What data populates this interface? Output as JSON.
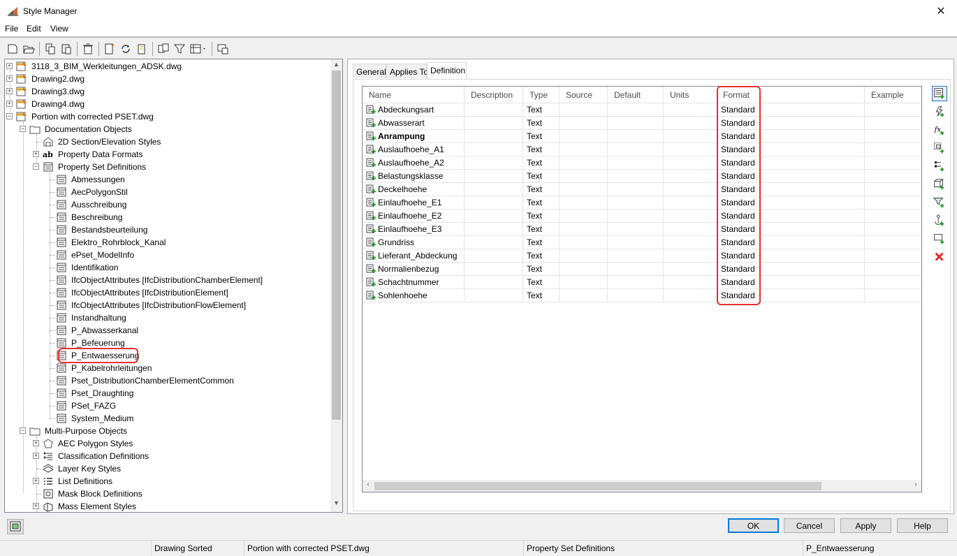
{
  "window": {
    "title": "Style Manager",
    "close_glyph": "✕"
  },
  "menu": {
    "items": [
      "File",
      "Edit",
      "View"
    ]
  },
  "toolbar": {
    "icons": [
      "new-drawing-icon",
      "open-drawing-icon",
      "copy-icon",
      "paste-icon",
      "purge-icon",
      "edit-style-icon",
      "synchronize-icon",
      "export-icon",
      "toggle-view-icon",
      "filter-icon",
      "view-options-icon",
      "inline-edit-icon"
    ]
  },
  "tree": {
    "drawings": [
      "3118_3_BIM_Werkleitungen_ADSK.dwg",
      "Drawing2.dwg",
      "Drawing3.dwg",
      "Drawing4.dwg",
      "Portion with corrected PSET.dwg"
    ],
    "documentation_objects": "Documentation Objects",
    "doc_children": [
      "2D Section/Elevation Styles",
      "Property Data Formats",
      "Property Set Definitions"
    ],
    "property_sets": [
      "Abmessungen",
      "AecPolygonStil",
      "Ausschreibung",
      "Beschreibung",
      "Bestandsbeurteilung",
      "Elektro_Rohrblock_Kanal",
      "ePset_ModelInfo",
      "Identifikation",
      "IfcObjectAttributes [IfcDistributionChamberElement]",
      "IfcObjectAttributes [IfcDistributionElement]",
      "IfcObjectAttributes [IfcDistributionFlowElement]",
      "Instandhaltung",
      "P_Abwasserkanal",
      "P_Befeuerung",
      "P_Entwaesserung",
      "P_Kabelrohrleitungen",
      "Pset_DistributionChamberElementCommon",
      "Pset_Draughting",
      "PSet_FAZG",
      "System_Medium"
    ],
    "multi_purpose_objects": "Multi-Purpose Objects",
    "mpo_children": [
      "AEC Polygon Styles",
      "Classification Definitions",
      "Layer Key Styles",
      "List Definitions",
      "Mask Block Definitions",
      "Mass Element Styles"
    ],
    "selected": "P_Entwaesserung"
  },
  "tabs": [
    "General",
    "Applies To",
    "Definition"
  ],
  "active_tab": "Definition",
  "grid": {
    "columns": [
      "Name",
      "Description",
      "Type",
      "Source",
      "Default",
      "Units",
      "Format",
      "Example"
    ],
    "rows": [
      {
        "name": "Abdeckungsart",
        "type": "Text",
        "format": "Standard"
      },
      {
        "name": "Abwasserart",
        "type": "Text",
        "format": "Standard"
      },
      {
        "name": "Anrampung",
        "type": "Text",
        "format": "Standard",
        "bold": true
      },
      {
        "name": "Auslaufhoehe_A1",
        "type": "Text",
        "format": "Standard"
      },
      {
        "name": "Auslaufhoehe_A2",
        "type": "Text",
        "format": "Standard"
      },
      {
        "name": "Belastungsklasse",
        "type": "Text",
        "format": "Standard"
      },
      {
        "name": "Deckelhoehe",
        "type": "Text",
        "format": "Standard"
      },
      {
        "name": "Einlaufhoehe_E1",
        "type": "Text",
        "format": "Standard"
      },
      {
        "name": "Einlaufhoehe_E2",
        "type": "Text",
        "format": "Standard"
      },
      {
        "name": "Einlaufhoehe_E3",
        "type": "Text",
        "format": "Standard"
      },
      {
        "name": "Grundriss",
        "type": "Text",
        "format": "Standard"
      },
      {
        "name": "Lieferant_Abdeckung",
        "type": "Text",
        "format": "Standard"
      },
      {
        "name": "Normalienbezug",
        "type": "Text",
        "format": "Standard"
      },
      {
        "name": "Schachtnummer",
        "type": "Text",
        "format": "Standard"
      },
      {
        "name": "Sohlenhoehe",
        "type": "Text",
        "format": "Standard"
      }
    ]
  },
  "side_buttons": [
    "add-manual-property-icon",
    "add-automatic-property-icon",
    "add-formula-property-icon",
    "add-location-property-icon",
    "add-classification-property-icon",
    "add-material-property-icon",
    "add-project-property-icon",
    "add-anchor-property-icon",
    "add-graphic-property-icon",
    "delete-property-icon"
  ],
  "buttons": {
    "ok": "OK",
    "cancel": "Cancel",
    "apply": "Apply",
    "help": "Help"
  },
  "status": {
    "sort": "Drawing Sorted",
    "drawing": "Portion with corrected PSET.dwg",
    "category": "Property Set Definitions",
    "style": "P_Entwaesserung"
  },
  "colors": {
    "highlight": "#e8302e",
    "accent": "#0078d7"
  }
}
